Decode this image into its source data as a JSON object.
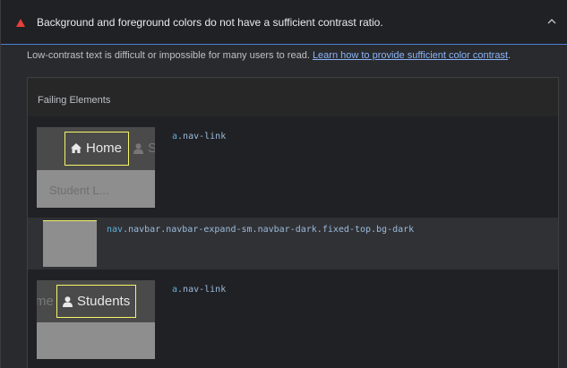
{
  "audit": {
    "title": "Background and foreground colors do not have a sufficient contrast ratio.",
    "status_icon": "fail-triangle-icon",
    "toggle_icon": "chevron-up-icon",
    "description_text": "Low-contrast text is difficult or impossible for many users to read. ",
    "learn_more_link": "Learn how to provide sufficient color contrast",
    "description_end": "."
  },
  "details": {
    "heading": "Failing Elements",
    "items": [
      {
        "selector_tag": "a",
        "selector_class": ".nav-link",
        "thumbnail": {
          "link_text": "Home",
          "link_icon": "home-icon",
          "next_text": "S",
          "next_icon": "user-icon",
          "ghost_text": "Student L..."
        }
      },
      {
        "selector_tag": "nav",
        "selector_class": ".navbar.navbar-expand-sm.navbar-dark.fixed-top.bg-dark"
      },
      {
        "selector_tag": "a",
        "selector_class": ".nav-link",
        "thumbnail": {
          "prev_text": "me",
          "link_text": "Students",
          "link_icon": "user-icon"
        }
      }
    ]
  },
  "colors": {
    "fail_red": "#e8403a",
    "link_blue": "#8ab4f8",
    "highlight_yellow": "#f5f56a",
    "header_border": "#4a80d6"
  }
}
